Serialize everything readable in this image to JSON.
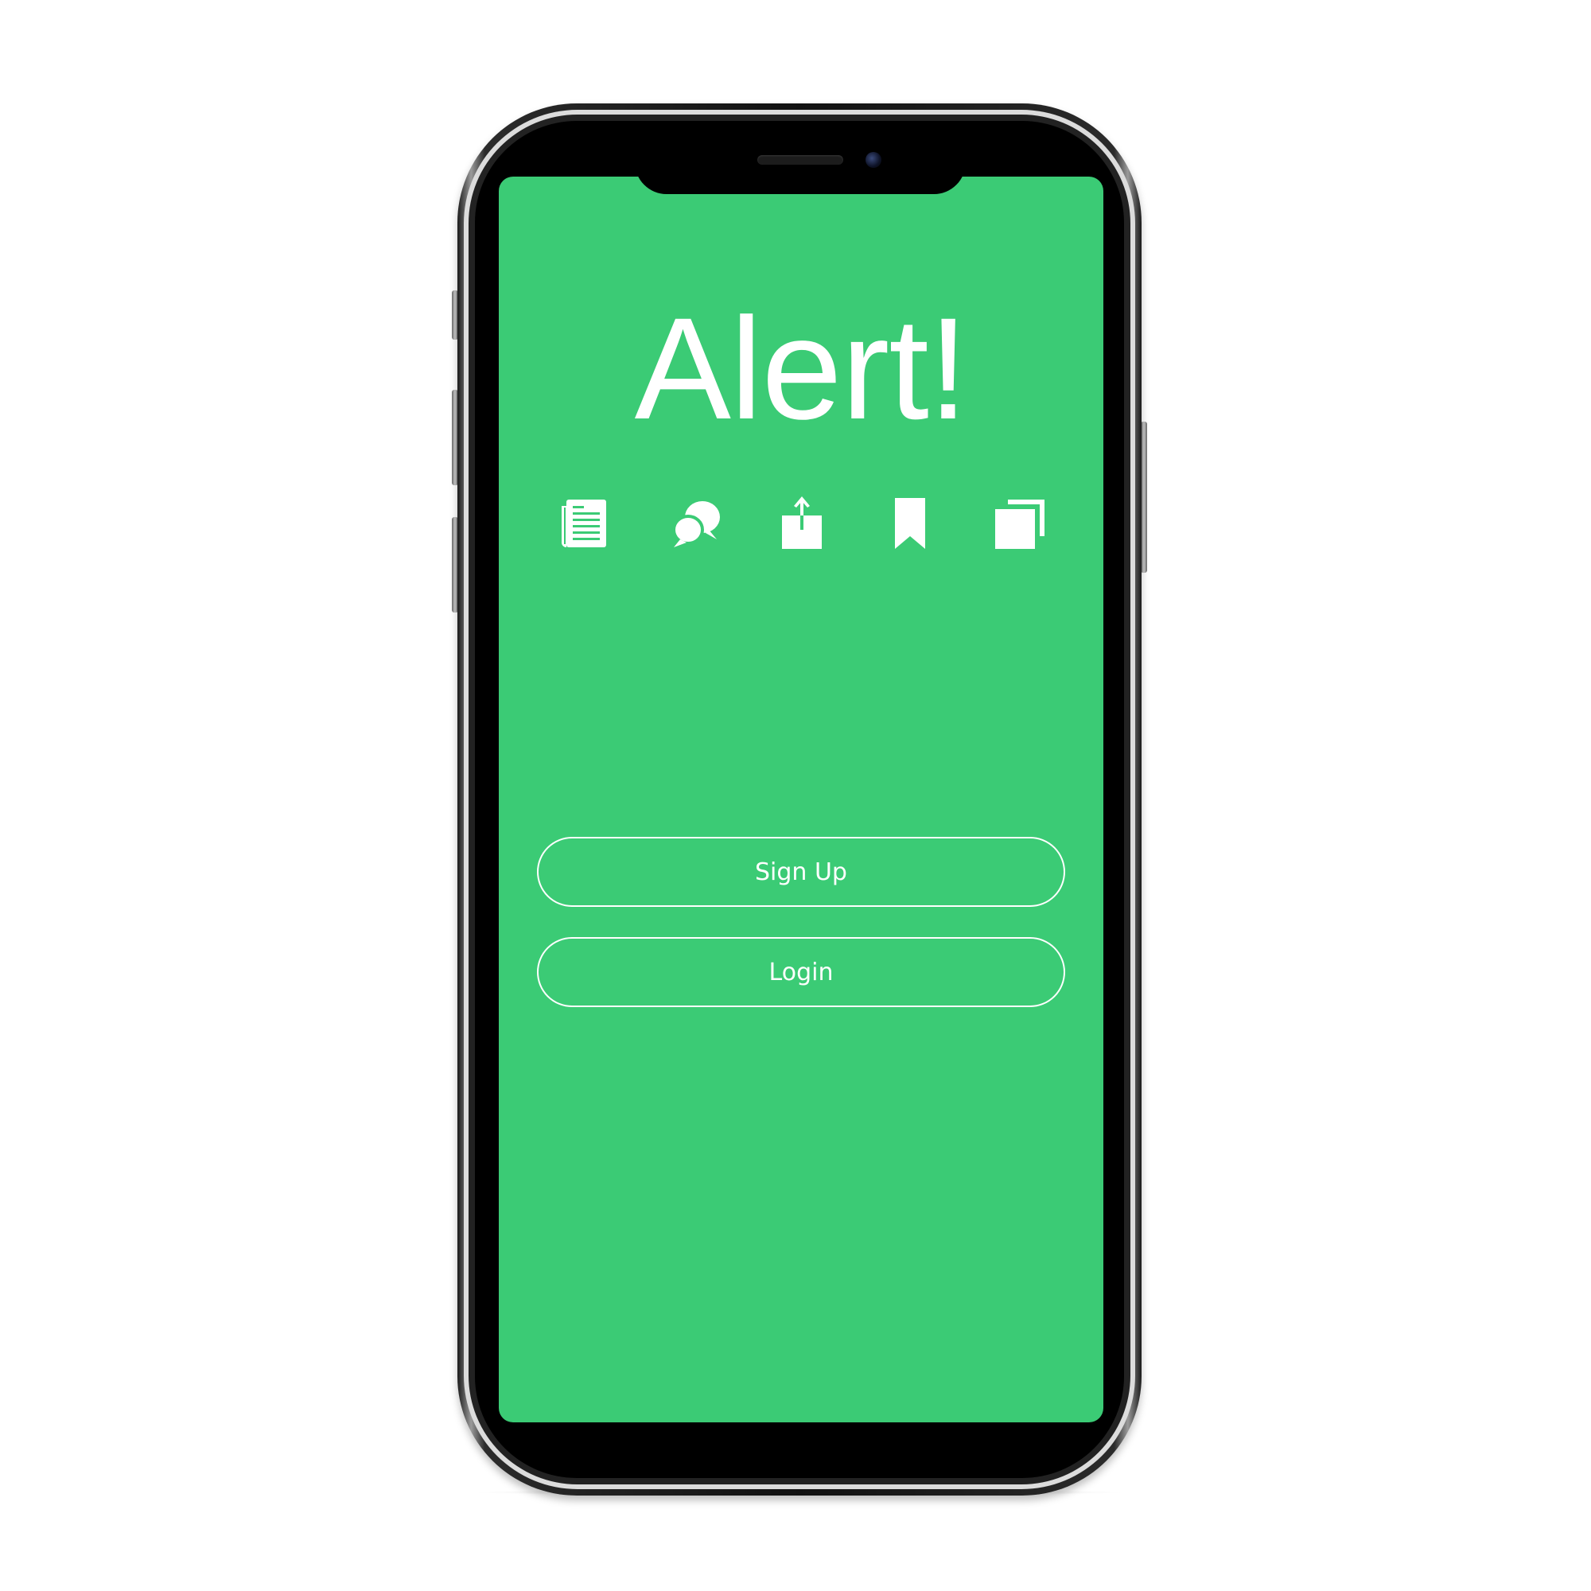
{
  "app": {
    "title": "Alert!",
    "background_color": "#3bcb75",
    "foreground_color": "#ffffff"
  },
  "icons": [
    {
      "name": "newspaper-icon"
    },
    {
      "name": "chat-bubbles-icon"
    },
    {
      "name": "share-icon"
    },
    {
      "name": "bookmark-icon"
    },
    {
      "name": "copy-icon"
    }
  ],
  "buttons": {
    "signup_label": "Sign Up",
    "login_label": "Login"
  }
}
